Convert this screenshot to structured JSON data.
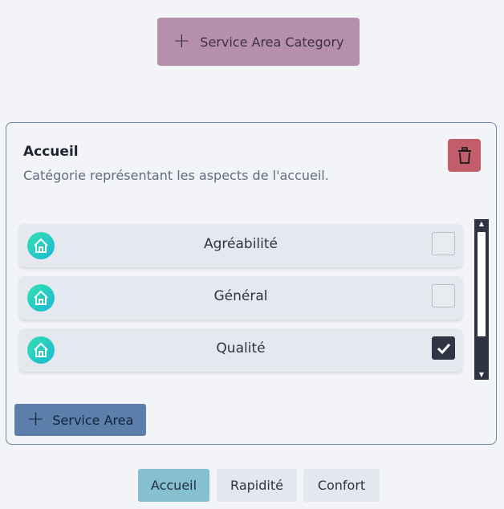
{
  "header": {
    "add_category_label": "Service Area Category"
  },
  "category": {
    "title": "Accueil",
    "description": "Catégorie représentant les aspects de l'accueil.",
    "items": [
      {
        "label": "Agréabilité",
        "icon": "home-icon",
        "checked": false
      },
      {
        "label": "Général",
        "icon": "home-icon",
        "checked": false
      },
      {
        "label": "Qualité",
        "icon": "home-icon",
        "checked": true
      }
    ],
    "add_area_label": "Service Area"
  },
  "tabs": [
    {
      "label": "Accueil",
      "active": true
    },
    {
      "label": "Rapidité",
      "active": false
    },
    {
      "label": "Confort",
      "active": false
    }
  ],
  "colors": {
    "accent_category_button": "#b68fac",
    "delete_button": "#c25e6b",
    "add_area_button": "#5b7eab",
    "active_tab": "#85bfd0"
  }
}
